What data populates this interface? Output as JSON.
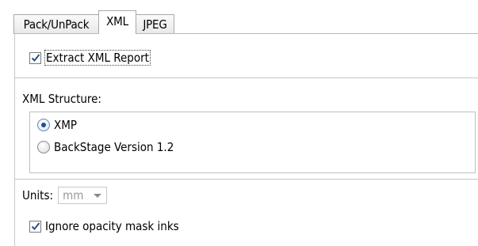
{
  "tabs": [
    {
      "label": "Pack/UnPack",
      "active": false
    },
    {
      "label": "XML",
      "active": true
    },
    {
      "label": "JPEG",
      "active": false
    }
  ],
  "extract_report": {
    "label": "Extract XML Report",
    "checked": true
  },
  "xml_structure": {
    "label": "XML Structure:",
    "options": [
      {
        "label": "XMP",
        "selected": true
      },
      {
        "label": "BackStage Version 1.2",
        "selected": false
      }
    ]
  },
  "units": {
    "label": "Units:",
    "value": "mm",
    "enabled": false
  },
  "ignore_opacity": {
    "label": "Ignore opacity mask inks",
    "checked": true
  },
  "colors": {
    "accent": "#1e4f8c",
    "checkmark": "#2b4f8a"
  }
}
